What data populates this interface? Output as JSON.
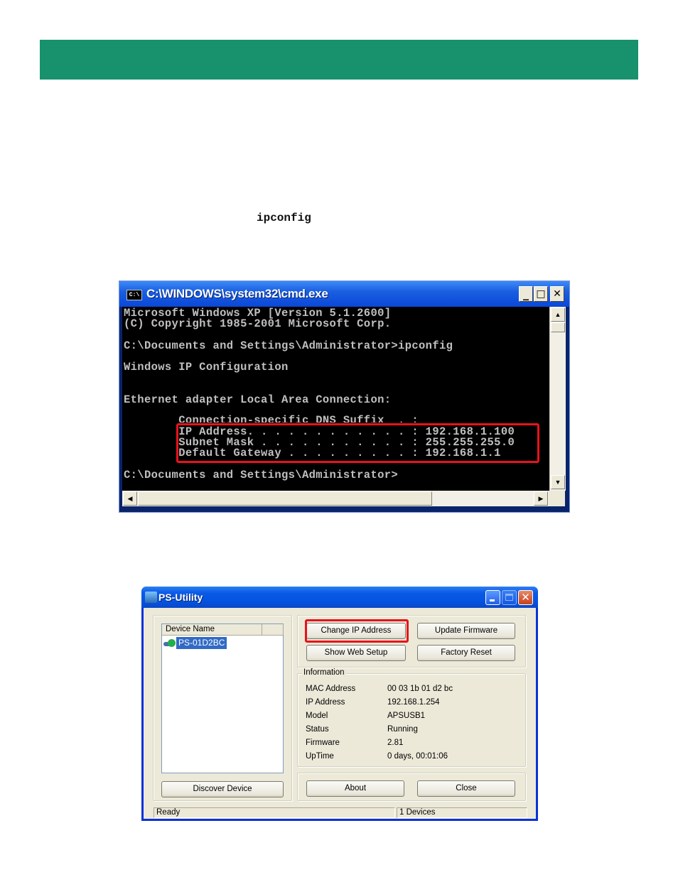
{
  "document": {
    "header_color": "#18926c",
    "inline_command": "ipconfig",
    "highlight_color": "#e8121b"
  },
  "cmd_window": {
    "title": "C:\\WINDOWS\\system32\\cmd.exe",
    "icon_label": "C:\\",
    "controls": {
      "minimize": "_",
      "maximize": "□",
      "close": "✕"
    },
    "lines": [
      "Microsoft Windows XP [Version 5.1.2600]",
      "(C) Copyright 1985-2001 Microsoft Corp.",
      "",
      "C:\\Documents and Settings\\Administrator>ipconfig",
      "",
      "Windows IP Configuration",
      "",
      "",
      "Ethernet adapter Local Area Connection:",
      "",
      "        Connection-specific DNS Suffix  . :",
      "        IP Address. . . . . . . . . . . . : 192.168.1.100",
      "        Subnet Mask . . . . . . . . . . . : 255.255.255.0",
      "        Default Gateway . . . . . . . . . : 192.168.1.1",
      "",
      "C:\\Documents and Settings\\Administrator>"
    ],
    "scroll": {
      "up": "▲",
      "down": "▼",
      "left": "◀",
      "right": "▶"
    }
  },
  "ps_utility": {
    "title": "PS-Utility",
    "list": {
      "column_header": "Device Name",
      "items": [
        {
          "name": "PS-01D2BC",
          "status": "online",
          "selected": true
        }
      ]
    },
    "buttons": {
      "change_ip": "Change IP Address",
      "update_firmware": "Update Firmware",
      "show_web_setup": "Show Web Setup",
      "factory_reset": "Factory Reset",
      "discover_device": "Discover Device",
      "about": "About",
      "close": "Close"
    },
    "information": {
      "legend": "Information",
      "rows": [
        {
          "key": "MAC Address",
          "value": "00 03 1b 01 d2 bc"
        },
        {
          "key": "IP Address",
          "value": "192.168.1.254"
        },
        {
          "key": "Model",
          "value": "APSUSB1"
        },
        {
          "key": "Status",
          "value": "Running"
        },
        {
          "key": "Firmware",
          "value": "2.81"
        },
        {
          "key": "UpTime",
          "value": "0 days, 00:01:06"
        }
      ]
    },
    "statusbar": {
      "left": "Ready",
      "right": "1 Devices"
    },
    "controls": {
      "close": "✕"
    }
  }
}
